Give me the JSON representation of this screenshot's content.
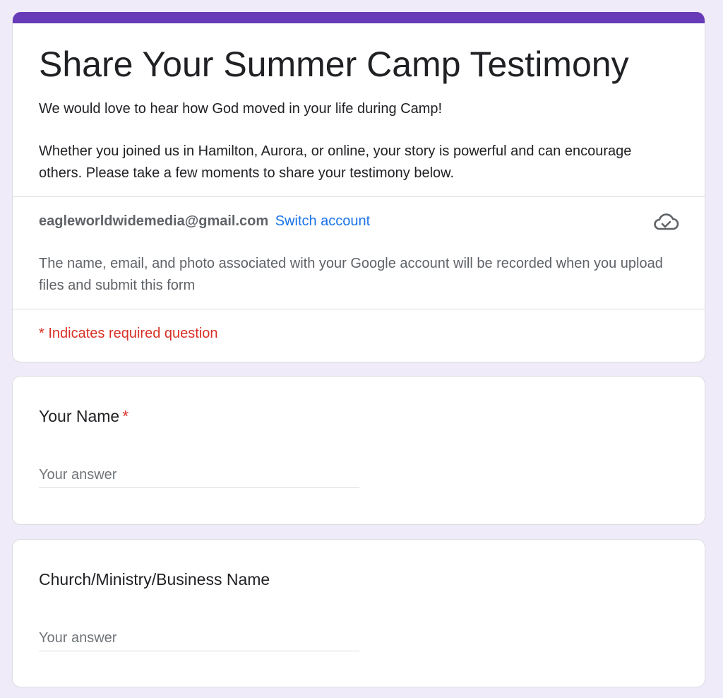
{
  "colors": {
    "accent": "#673ab7",
    "background": "#f0ebf8",
    "link": "#1a73e8",
    "required": "#d93025"
  },
  "form": {
    "title": "Share Your Summer Camp Testimony",
    "description_line1": "We would love to hear how God moved in your life during Camp!",
    "description_line2": "Whether you joined us in Hamilton, Aurora, or online, your story is powerful and can encourage others. Please take a few moments to share your testimony below."
  },
  "account": {
    "email": "eagleworldwidemedia@gmail.com",
    "switch_label": "Switch account",
    "status_icon": "cloud-check-icon",
    "notice": "The name, email, and photo associated with your Google account will be recorded when you upload files and submit this form"
  },
  "required_note": "* Indicates required question",
  "questions": [
    {
      "title": "Your Name",
      "required_mark": "*",
      "placeholder": "Your answer",
      "value": ""
    },
    {
      "title": "Church/Ministry/Business Name",
      "placeholder": "Your answer",
      "value": ""
    }
  ]
}
